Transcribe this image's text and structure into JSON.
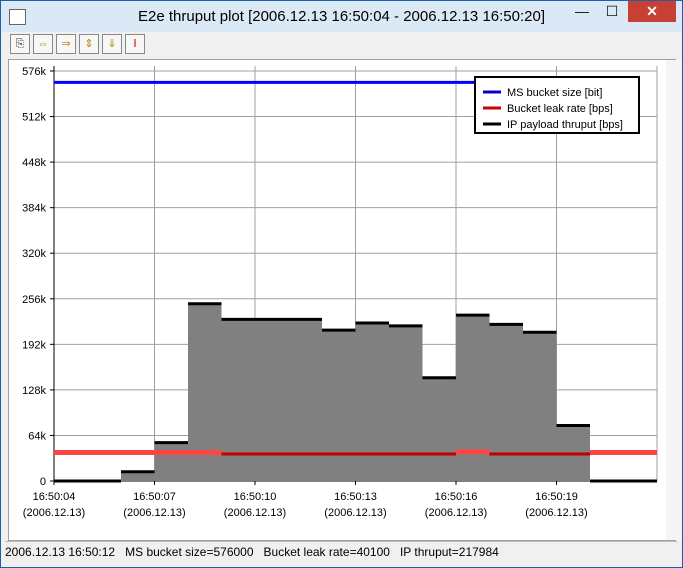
{
  "window": {
    "title": "E2e thruput plot [2006.12.13 16:50:04 - 2006.12.13 16:50:20]",
    "minimize_label": "—",
    "maximize_label": "☐",
    "close_label": "✕"
  },
  "toolbar": {
    "buttons": [
      {
        "icon": "copy-icon"
      },
      {
        "icon": "zoom-in-horizontal-icon"
      },
      {
        "icon": "zoom-out-horizontal-icon"
      },
      {
        "icon": "zoom-in-vertical-icon"
      },
      {
        "icon": "zoom-out-vertical-icon"
      },
      {
        "icon": "fit-to-window-icon"
      }
    ]
  },
  "chart_data": {
    "type": "line",
    "title": "",
    "xlabel": "",
    "ylabel": "",
    "x_ticks": [
      {
        "time": "16:50:04",
        "date": "(2006.12.13)"
      },
      {
        "time": "16:50:07",
        "date": "(2006.12.13)"
      },
      {
        "time": "16:50:10",
        "date": "(2006.12.13)"
      },
      {
        "time": "16:50:13",
        "date": "(2006.12.13)"
      },
      {
        "time": "16:50:16",
        "date": "(2006.12.13)"
      },
      {
        "time": "16:50:19",
        "date": "(2006.12.13)"
      }
    ],
    "y_ticks": [
      "0",
      "64k",
      "128k",
      "192k",
      "256k",
      "320k",
      "384k",
      "448k",
      "512k",
      "576k"
    ],
    "ylim": [
      0,
      576000
    ],
    "xlim": [
      "16:50:04",
      "16:50:22"
    ],
    "grid": true,
    "legend_position": "top-right",
    "series": [
      {
        "name": "MS bucket size [bit]",
        "color": "#0000ff",
        "style": "step",
        "points": [
          [
            "16:50:04",
            560000
          ],
          [
            "16:50:21",
            560000
          ]
        ]
      },
      {
        "name": "Bucket leak rate [bps]",
        "color": "#e03030",
        "style": "step",
        "points": [
          [
            "16:50:04",
            40000
          ],
          [
            "16:50:05",
            40000
          ],
          [
            "16:50:06",
            40000
          ],
          [
            "16:50:07",
            40000
          ],
          [
            "16:50:08",
            40000
          ],
          [
            "16:50:09",
            38000
          ],
          [
            "16:50:10",
            38000
          ],
          [
            "16:50:11",
            38000
          ],
          [
            "16:50:12",
            38000
          ],
          [
            "16:50:13",
            38000
          ],
          [
            "16:50:14",
            38000
          ],
          [
            "16:50:15",
            38000
          ],
          [
            "16:50:16",
            41000
          ],
          [
            "16:50:17",
            38000
          ],
          [
            "16:50:18",
            38000
          ],
          [
            "16:50:19",
            38000
          ],
          [
            "16:50:20",
            40000
          ],
          [
            "16:50:21",
            40000
          ]
        ]
      },
      {
        "name": "IP payload thruput [bps]",
        "color": "#000000",
        "style": "step-filled",
        "fill": "#808080",
        "points": [
          [
            "16:50:04",
            0
          ],
          [
            "16:50:05",
            0
          ],
          [
            "16:50:06",
            13000
          ],
          [
            "16:50:07",
            54000
          ],
          [
            "16:50:08",
            249000
          ],
          [
            "16:50:09",
            227000
          ],
          [
            "16:50:10",
            227000
          ],
          [
            "16:50:11",
            227000
          ],
          [
            "16:50:12",
            212000
          ],
          [
            "16:50:13",
            222000
          ],
          [
            "16:50:14",
            218000
          ],
          [
            "16:50:15",
            145000
          ],
          [
            "16:50:16",
            233000
          ],
          [
            "16:50:17",
            220000
          ],
          [
            "16:50:18",
            209000
          ],
          [
            "16:50:19",
            78000
          ],
          [
            "16:50:20",
            0
          ],
          [
            "16:50:21",
            0
          ]
        ]
      }
    ]
  },
  "status": {
    "text": "2006.12.13 16:50:12   MS bucket size=576000   Bucket leak rate=40100   IP thruput=217984"
  }
}
